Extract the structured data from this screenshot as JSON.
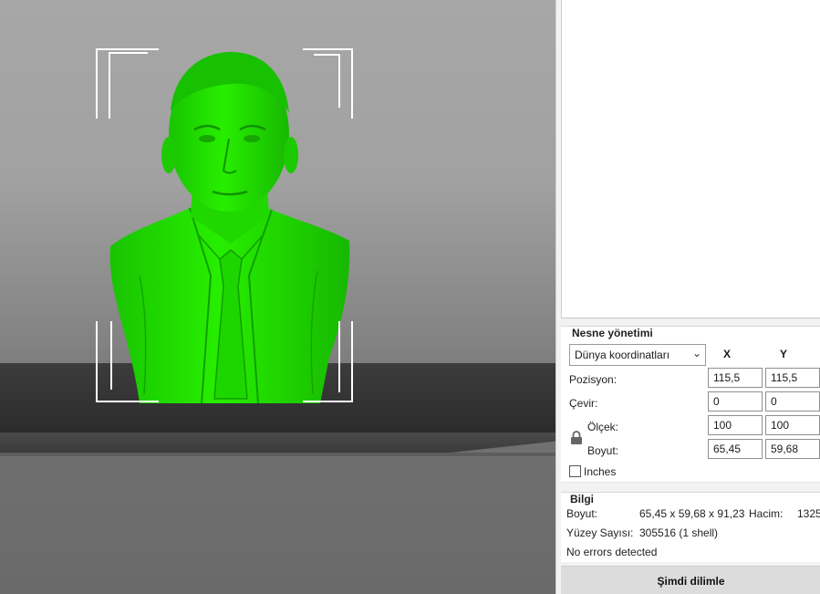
{
  "object_management": {
    "title": "Nesne yönetimi",
    "coord_select": {
      "value": "Dünya koordinatları"
    },
    "col_x": "X",
    "col_y": "Y",
    "position_label": "Pozisyon:",
    "rotate_label": "Çevir:",
    "scale_label": "Ölçek:",
    "size_label": "Boyut:",
    "position": {
      "x": "115,5",
      "y": "115,5"
    },
    "rotate": {
      "x": "0",
      "y": "0"
    },
    "scale": {
      "x": "100",
      "y": "100"
    },
    "size": {
      "x": "65,45",
      "y": "59,68"
    },
    "inches_label": "Inches",
    "inches_checked": false,
    "icons": {
      "lock": "lock-icon",
      "dropdown": "chevron-down-icon"
    }
  },
  "info": {
    "title": "Bilgi",
    "size_label": "Boyut:",
    "size_value": "65,45 x 59,68 x 91,23",
    "volume_label": "Hacim:",
    "volume_value": "1325",
    "faces_label": "Yüzey Sayısı:",
    "faces_value": "305516 (1 shell)",
    "errors": "No errors detected"
  },
  "slice_button": {
    "label": "Şimdi dilimle"
  },
  "colors": {
    "model": "#22e000",
    "bed": "#353535",
    "viewport_bg": "#a3a3a3"
  }
}
